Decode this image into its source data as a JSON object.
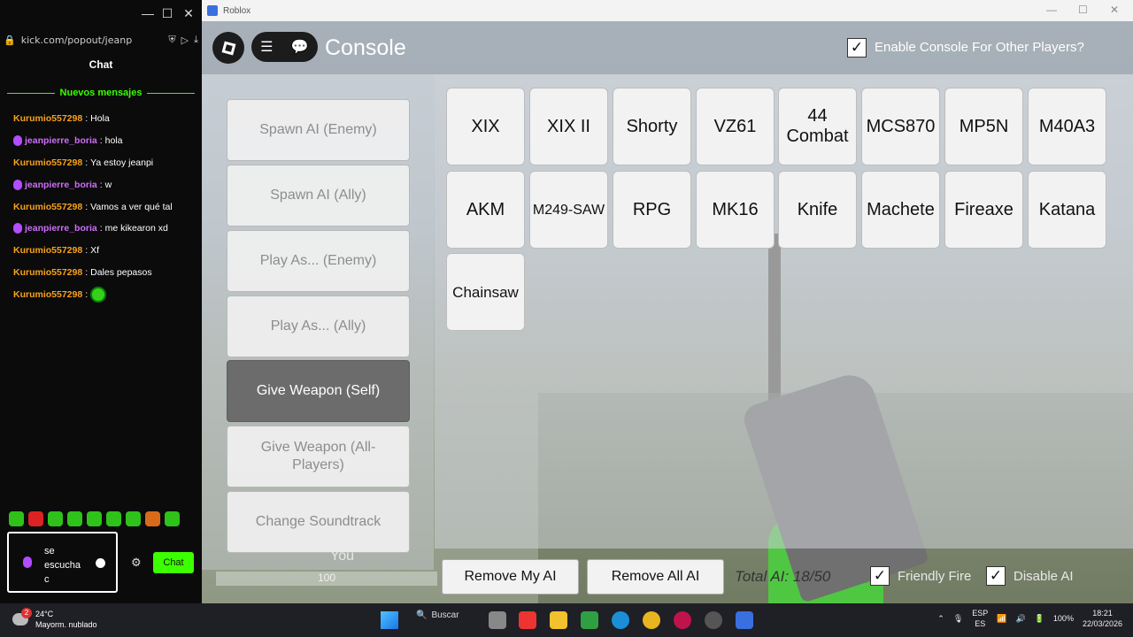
{
  "kick": {
    "url": "kick.com/popout/jeanp",
    "chat_title": "Chat",
    "new_messages": "Nuevos mensajes",
    "messages": [
      {
        "user": "Kurumio557298",
        "text": "Hola"
      },
      {
        "user": "jeanpierre_boria",
        "text": "hola"
      },
      {
        "user": "Kurumio557298",
        "text": "Ya estoy jeanpi"
      },
      {
        "user": "jeanpierre_boria",
        "text": "w"
      },
      {
        "user": "Kurumio557298",
        "text": "Vamos a ver qué tal"
      },
      {
        "user": "jeanpierre_boria",
        "text": "me kikearon xd"
      },
      {
        "user": "Kurumio557298",
        "text": "Xf"
      },
      {
        "user": "Kurumio557298",
        "text": "Dales pepasos"
      },
      {
        "user": "Kurumio557298",
        "text": ""
      }
    ],
    "input_value": "se escucha c",
    "send_label": "Chat",
    "colors": {
      "accent": "#3cff00",
      "user_a": "#f7a21b",
      "user_b": "#ce6df7"
    }
  },
  "roblox": {
    "window_title": "Roblox",
    "console_title": "Console",
    "enable_console_label": "Enable Console For Other Players?",
    "left_buttons": [
      {
        "label": "Spawn AI (Enemy)",
        "active": false
      },
      {
        "label": "Spawn AI (Ally)",
        "active": false
      },
      {
        "label": "Play As... (Enemy)",
        "active": false
      },
      {
        "label": "Play As... (Ally)",
        "active": false
      },
      {
        "label": "Give Weapon (Self)",
        "active": true
      },
      {
        "label": "Give Weapon (All-Players)",
        "active": false
      },
      {
        "label": "Change Soundtrack",
        "active": false
      }
    ],
    "weapons": [
      "XIX",
      "XIX II",
      "Shorty",
      "VZ61",
      "44 Combat",
      "MCS870",
      "MP5N",
      "M40A3",
      "AKM",
      "M249-SAW",
      "RPG",
      "MK16",
      "Knife",
      "Machete",
      "Fireaxe",
      "Katana",
      "Chainsaw"
    ],
    "you_label": "You",
    "health": "100",
    "remove_my_ai": "Remove My AI",
    "remove_all_ai": "Remove All AI",
    "total_ai": "Total AI: 18/50",
    "friendly_fire_label": "Friendly Fire",
    "disable_ai_label": "Disable AI"
  },
  "taskbar": {
    "temperature": "24°C",
    "weather": "Mayorm. nublado",
    "weather_badge": "2",
    "search_label": "Buscar",
    "lang_top": "ESP",
    "lang_bottom": "ES",
    "battery": "100%",
    "time": "18:21",
    "date": "22/03/2026"
  }
}
